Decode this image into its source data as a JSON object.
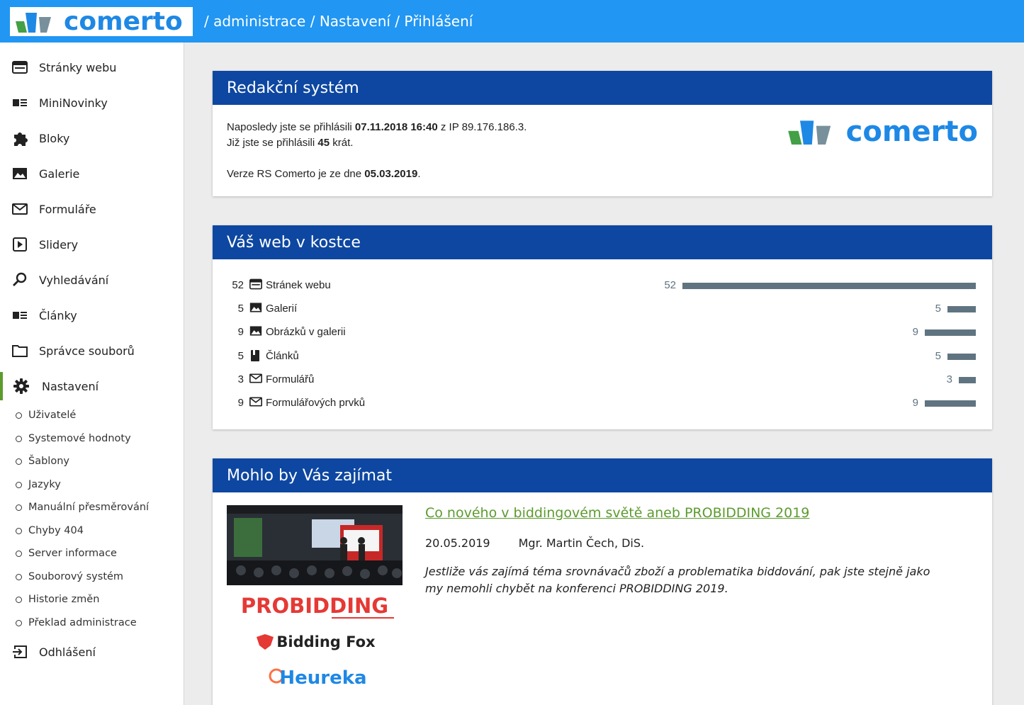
{
  "header": {
    "logo_text": "comerto",
    "breadcrumb": "/ administrace / Nastavení / Přihlášení"
  },
  "sidebar": {
    "items": [
      {
        "label": "Stránky webu",
        "icon": "web-page-icon"
      },
      {
        "label": "MiniNovinky",
        "icon": "news-list-icon"
      },
      {
        "label": "Bloky",
        "icon": "puzzle-icon"
      },
      {
        "label": "Galerie",
        "icon": "image-icon"
      },
      {
        "label": "Formuláře",
        "icon": "mail-icon"
      },
      {
        "label": "Slidery",
        "icon": "slider-play-icon"
      },
      {
        "label": "Vyhledávání",
        "icon": "search-icon"
      },
      {
        "label": "Články",
        "icon": "articles-icon"
      },
      {
        "label": "Správce souborů",
        "icon": "folder-icon"
      },
      {
        "label": "Nastavení",
        "icon": "gear-icon",
        "active": true
      }
    ],
    "subitems": [
      "Uživatelé",
      "Systemové hodnoty",
      "Šablony",
      "Jazyky",
      "Manuální přesměrování",
      "Chyby 404",
      "Server informace",
      "Souborový systém",
      "Historie změn",
      "Překlad administrace"
    ],
    "logout": {
      "label": "Odhlášení",
      "icon": "logout-icon"
    }
  },
  "cms_card": {
    "title": "Redakční systém",
    "line1_prefix": "Naposledy jste se přihlásili ",
    "last_login": "07.11.2018 16:40",
    "line1_mid": " z IP ",
    "ip": "89.176.186.3.",
    "line2_prefix": "Již jste se přihlásili ",
    "login_count": "45",
    "line2_suffix": " krát.",
    "line3_prefix": "Verze RS Comerto je ze dne ",
    "version_date": "05.03.2019",
    "line3_suffix": ".",
    "logo_text": "comerto"
  },
  "stats_card": {
    "title": "Váš web v kostce",
    "max": 52,
    "rows": [
      {
        "count": "52",
        "label": "Stránek webu",
        "icon": "web-page-icon",
        "value": 52
      },
      {
        "count": "5",
        "label": "Galerií",
        "icon": "image-icon",
        "value": 5
      },
      {
        "count": "9",
        "label": "Obrázků v galerii",
        "icon": "image-icon",
        "value": 9
      },
      {
        "count": "5",
        "label": "Článků",
        "icon": "book-icon",
        "value": 5
      },
      {
        "count": "3",
        "label": "Formulářů",
        "icon": "mail-icon",
        "value": 3
      },
      {
        "count": "9",
        "label": "Formulářových prvků",
        "icon": "mail-icon",
        "value": 9
      }
    ]
  },
  "news_card": {
    "title": "Mohlo by Vás zajímat",
    "article": {
      "title": "Co nového v biddingovém světě aneb PROBIDDING 2019",
      "date": "20.05.2019",
      "author": "Mgr. Martin Čech, DiS.",
      "text": "Jestliže vás zajímá téma srovnávačů zboží a problematika biddování, pak jste stejně jako my nemohli chybět na konferenci PROBIDDING 2019.",
      "image_brands": [
        "PROBIDDING",
        "Bidding Fox",
        "Heureka"
      ]
    }
  },
  "colors": {
    "header": "#2196f3",
    "card_head": "#0d47a1",
    "accent_green": "#5c9b2e",
    "bar": "#5f7480"
  }
}
